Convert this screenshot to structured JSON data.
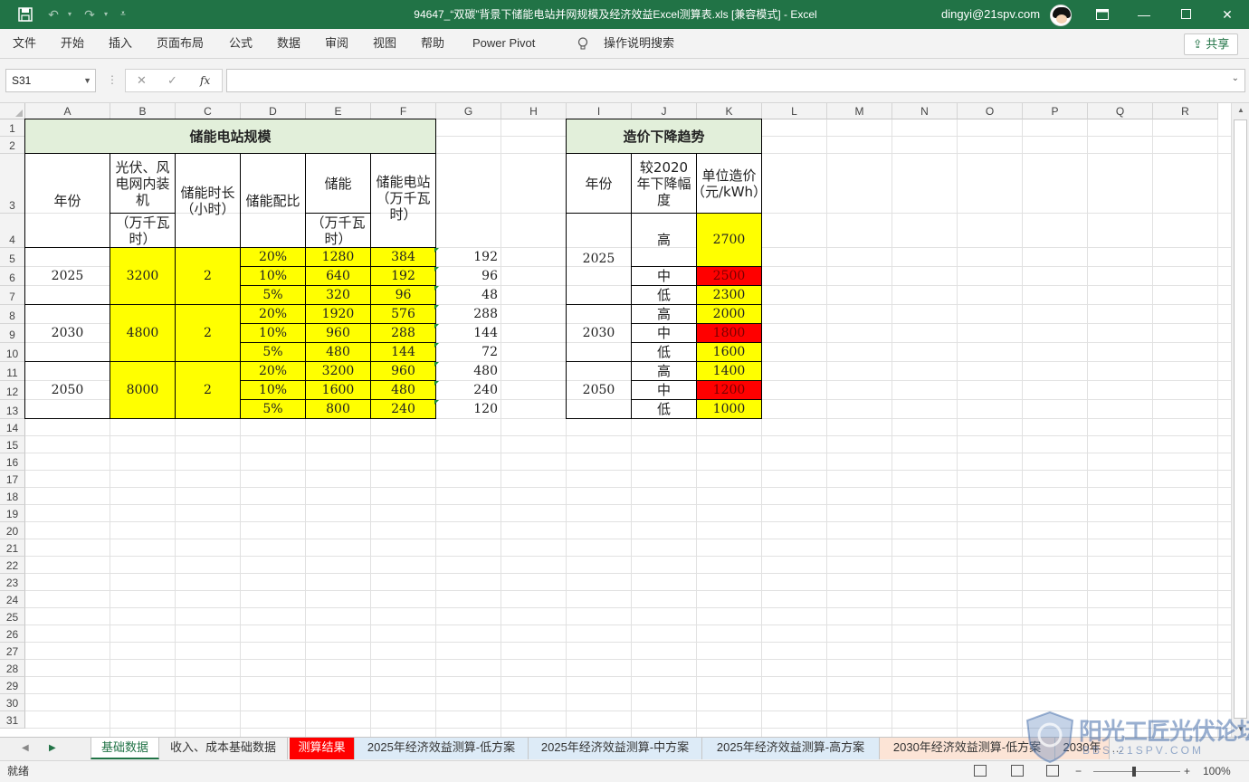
{
  "window": {
    "title": "94647_“双碳”背景下储能电站并网规模及经济效益Excel测算表.xls  [兼容模式]  -  Excel",
    "user": "dingyi@21spv.com"
  },
  "menu": {
    "items": [
      "文件",
      "开始",
      "插入",
      "页面布局",
      "公式",
      "数据",
      "审阅",
      "视图",
      "帮助",
      "Power Pivot"
    ],
    "tell_me": "操作说明搜索",
    "share": "共享"
  },
  "formula_bar": {
    "name_box": "S31",
    "formula": ""
  },
  "columns": [
    "A",
    "B",
    "C",
    "D",
    "E",
    "F",
    "G",
    "H",
    "I",
    "J",
    "K",
    "L",
    "M",
    "N",
    "O",
    "P",
    "Q",
    "R"
  ],
  "rows": [
    "1",
    "2",
    "3",
    "4",
    "5",
    "6",
    "7",
    "8",
    "9",
    "10",
    "11",
    "12",
    "13",
    "14",
    "15",
    "16",
    "17",
    "18",
    "19",
    "20",
    "21",
    "22",
    "23",
    "24",
    "25",
    "26",
    "27",
    "28",
    "29",
    "30",
    "31"
  ],
  "table1": {
    "title": "储能电站规模",
    "headers": {
      "year": "年份",
      "capacity": "光伏、风电网内装机",
      "capacity_unit": "（万千瓦时）",
      "duration": "储能时长（小时）",
      "ratio": "储能配比",
      "storage": "储能",
      "storage_unit": "（万千瓦时）",
      "station": "储能电站（万千瓦时）"
    },
    "groups": [
      {
        "year": "2025",
        "capacity": "3200",
        "duration": "2",
        "rows": [
          {
            "ratio": "20%",
            "storage": "1280",
            "station": "384",
            "g": "192"
          },
          {
            "ratio": "10%",
            "storage": "640",
            "station": "192",
            "g": "96"
          },
          {
            "ratio": "5%",
            "storage": "320",
            "station": "96",
            "g": "48"
          }
        ]
      },
      {
        "year": "2030",
        "capacity": "4800",
        "duration": "2",
        "rows": [
          {
            "ratio": "20%",
            "storage": "1920",
            "station": "576",
            "g": "288"
          },
          {
            "ratio": "10%",
            "storage": "960",
            "station": "288",
            "g": "144"
          },
          {
            "ratio": "5%",
            "storage": "480",
            "station": "144",
            "g": "72"
          }
        ]
      },
      {
        "year": "2050",
        "capacity": "8000",
        "duration": "2",
        "rows": [
          {
            "ratio": "20%",
            "storage": "3200",
            "station": "960",
            "g": "480"
          },
          {
            "ratio": "10%",
            "storage": "1600",
            "station": "480",
            "g": "240"
          },
          {
            "ratio": "5%",
            "storage": "800",
            "station": "240",
            "g": "120"
          }
        ]
      }
    ]
  },
  "table2": {
    "title": "造价下降趋势",
    "headers": {
      "year": "年份",
      "decline": "较2020年下降幅度",
      "unit_cost": "单位造价（元/kWh）"
    },
    "groups": [
      {
        "year": "2025",
        "rows": [
          {
            "level": "高",
            "cost": "2700"
          },
          {
            "level": "中",
            "cost": "2500"
          },
          {
            "level": "低",
            "cost": "2300"
          }
        ]
      },
      {
        "year": "2030",
        "rows": [
          {
            "level": "高",
            "cost": "2000"
          },
          {
            "level": "中",
            "cost": "1800"
          },
          {
            "level": "低",
            "cost": "1600"
          }
        ]
      },
      {
        "year": "2050",
        "rows": [
          {
            "level": "高",
            "cost": "1400"
          },
          {
            "level": "中",
            "cost": "1200"
          },
          {
            "level": "低",
            "cost": "1000"
          }
        ]
      }
    ]
  },
  "sheet_tabs": [
    "基础数据",
    "收入、成本基础数据",
    "测算结果",
    "2025年经济效益测算-低方案",
    "2025年经济效益测算-中方案",
    "2025年经济效益测算-高方案",
    "2030年经济效益测算-低方案",
    "2030年"
  ],
  "status": {
    "ready": "就绪",
    "zoom": "100%"
  },
  "watermark": {
    "main": "阳光工匠光伏论坛",
    "sub": "BBS.21SPV.COM"
  },
  "colors": {
    "excel_green": "#217346",
    "fill_yellow": "#ffff00",
    "fill_red": "#ff0000",
    "header_green": "#e2efda",
    "tab_red": "#ff0000"
  }
}
